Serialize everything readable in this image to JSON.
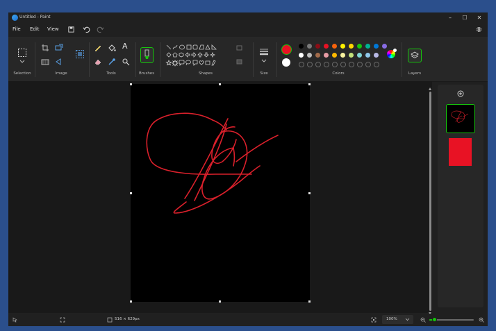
{
  "window": {
    "title": "Untitled - Paint",
    "minimize": "–",
    "maximize": "☐",
    "close": "✕"
  },
  "menu": {
    "file": "File",
    "edit": "Edit",
    "view": "View"
  },
  "ribbon": {
    "groups": {
      "selection": "Selection",
      "image": "Image",
      "tools": "Tools",
      "brushes": "Brushes",
      "shapes": "Shapes",
      "size": "Size",
      "colors": "Colors",
      "layers": "Layers"
    },
    "text_tool": "A"
  },
  "colors": {
    "primary": "#e81224",
    "secondary": "#ffffff",
    "row1": [
      "#000000",
      "#7a7a7a",
      "#8a0d16",
      "#e81224",
      "#f7630c",
      "#fff100",
      "#ffd700",
      "#16c60c",
      "#00b294",
      "#0078d7",
      "#886ce4"
    ],
    "row2": [
      "#ffffff",
      "#bfbfbf",
      "#a36b4a",
      "#e89ca5",
      "#ffb900",
      "#f9f3a0",
      "#c3e27a",
      "#7fd6d6",
      "#90c8ea",
      "#b8b9e6"
    ],
    "empty_count": 10,
    "accent": "#16c60c",
    "panel": "#272727",
    "canvas_bg": "#000000",
    "stroke": "#d9202b"
  },
  "layers": {
    "thumbnail_selected": true,
    "color_swatch": "#e81224"
  },
  "status": {
    "canvas_size": "516 × 629px",
    "zoom": "100%",
    "zoom_fraction": 0.12
  }
}
